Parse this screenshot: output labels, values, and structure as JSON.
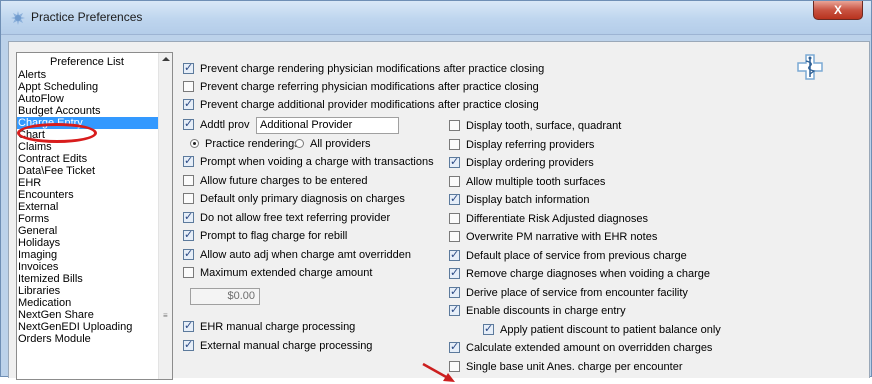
{
  "window": {
    "title": "Practice Preferences",
    "close_label": "X"
  },
  "preference_list": {
    "header": "Preference List",
    "items": [
      "Alerts",
      "Appt Scheduling",
      "AutoFlow",
      "Budget Accounts",
      "Charge Entry",
      "Chart",
      "Claims",
      "Contract Edits",
      "Data\\Fee Ticket",
      "EHR",
      "Encounters",
      "External",
      "Forms",
      "General",
      "Holidays",
      "Imaging",
      "Invoices",
      "Itemized Bills",
      "Libraries",
      "Medication",
      "NextGen Share",
      "NextGenEDI Uploading",
      "Orders Module"
    ],
    "selected": "Charge Entry"
  },
  "top_options": [
    {
      "label": "Prevent charge rendering physician modifications after practice closing",
      "checked": true
    },
    {
      "label": "Prevent charge referring physician modifications after practice closing",
      "checked": false
    },
    {
      "label": "Prevent charge additional provider modifications after practice closing",
      "checked": true
    }
  ],
  "addtl_prov": {
    "label": "Addtl prov",
    "checked": true,
    "value": "Additional Provider"
  },
  "provider_radio": [
    {
      "label": "Practice renderings",
      "selected": true
    },
    {
      "label": "All providers",
      "selected": false
    }
  ],
  "left_options": [
    {
      "label": "Prompt when voiding a charge with transactions",
      "checked": true
    },
    {
      "label": "Allow future charges to be entered",
      "checked": false
    },
    {
      "label": "Default only primary diagnosis on charges",
      "checked": false
    },
    {
      "label": "Do not allow free text referring provider",
      "checked": true
    },
    {
      "label": "Prompt to flag charge for rebill",
      "checked": true
    },
    {
      "label": "Allow auto adj when charge amt overridden",
      "checked": true
    },
    {
      "label": "Maximum extended charge amount",
      "checked": false
    }
  ],
  "max_amount": {
    "value": "$0.00"
  },
  "left_bottom_options": [
    {
      "label": "EHR manual charge processing",
      "checked": true
    },
    {
      "label": "External manual charge processing",
      "checked": true
    }
  ],
  "right_options": [
    {
      "label": "Display tooth, surface, quadrant",
      "checked": false
    },
    {
      "label": "Display referring providers",
      "checked": false
    },
    {
      "label": "Display ordering providers",
      "checked": true
    },
    {
      "label": "Allow multiple tooth surfaces",
      "checked": false
    },
    {
      "label": "Display batch information",
      "checked": true
    },
    {
      "label": "Differentiate Risk Adjusted diagnoses",
      "checked": false
    },
    {
      "label": "Overwrite PM narrative with EHR notes",
      "checked": false
    },
    {
      "label": "Default place of service from previous charge",
      "checked": true
    },
    {
      "label": "Remove charge diagnoses when voiding a charge",
      "checked": true
    },
    {
      "label": "Derive place of service from encounter facility",
      "checked": true
    },
    {
      "label": "Enable discounts in charge entry",
      "checked": true
    },
    {
      "label": "Apply patient discount to patient balance only",
      "checked": true
    },
    {
      "label": "Calculate extended amount on overridden charges",
      "checked": true
    },
    {
      "label": "Single base unit Anes. charge per encounter",
      "checked": false
    }
  ],
  "colors": {
    "selection": "#3399ff",
    "annotation": "#d81c1c",
    "titlebar": "#bed5ee"
  },
  "icons": {
    "title": "preferences-icon",
    "logo": "caduceus-icon"
  }
}
